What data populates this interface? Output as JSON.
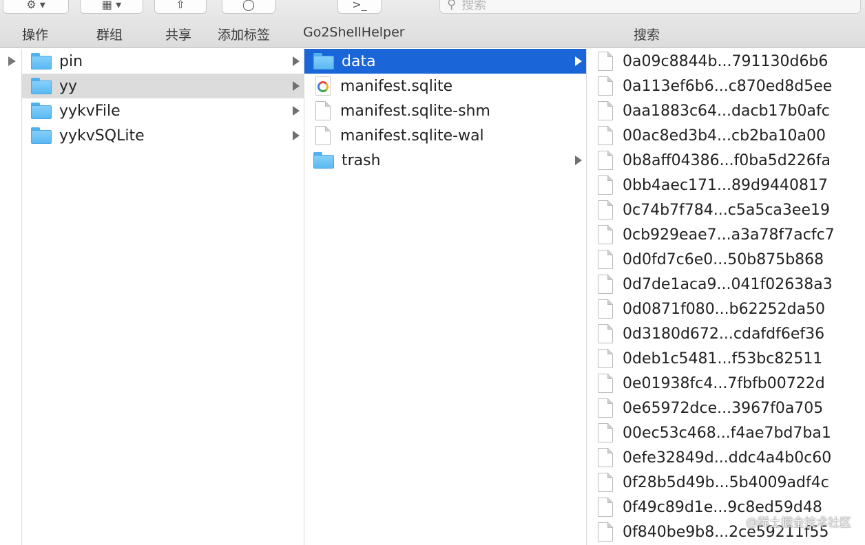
{
  "toolbar": {
    "labels": [
      "操作",
      "群组",
      "共享",
      "添加标签",
      "Go2ShellHelper",
      "搜索"
    ],
    "search_placeholder": "搜索"
  },
  "columns": {
    "col1": [
      {
        "name": "pin",
        "type": "folder"
      },
      {
        "name": "yy",
        "type": "folder",
        "state": "dim"
      },
      {
        "name": "yykvFile",
        "type": "folder"
      },
      {
        "name": "yykvSQLite",
        "type": "folder"
      }
    ],
    "col2": [
      {
        "name": "data",
        "type": "folder",
        "state": "selected",
        "arrow": true
      },
      {
        "name": "manifest.sqlite",
        "type": "sqlite"
      },
      {
        "name": "manifest.sqlite-shm",
        "type": "doc"
      },
      {
        "name": "manifest.sqlite-wal",
        "type": "doc"
      },
      {
        "name": "trash",
        "type": "folder",
        "arrow": true
      }
    ],
    "col3": [
      "0a09c8844b...791130d6b6",
      "0a113ef6b6...c870ed8d5ee",
      "0aa1883c64...dacb17b0afc",
      "00ac8ed3b4...cb2ba10a00",
      "0b8aff04386...f0ba5d226fa",
      "0bb4aec171...89d9440817",
      "0c74b7f784...c5a5ca3ee19",
      "0cb929eae7...a3a78f7acfc7",
      "0d0fd7c6e0...50b875b868",
      "0d7de1aca9...041f02638a3",
      "0d0871f080...b62252da50",
      "0d3180d672...cdafdf6ef36",
      "0deb1c5481...f53bc82511",
      "0e01938fc4...7fbfb00722d",
      "0e65972dce...3967f0a705",
      "00ec53c468...f4ae7bd7ba1",
      "0efe32849d...ddc4a4b0c60",
      "0f28b5d49b...5b4009adf4c",
      "0f49c89d1e...9c8ed59d48",
      "0f840be9b8...2ce59211f55"
    ]
  },
  "watermark": "@稀土掘金技术社区"
}
